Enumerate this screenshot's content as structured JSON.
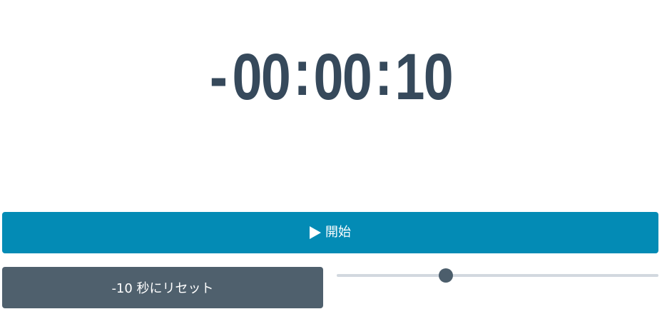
{
  "timer": {
    "sign": "-",
    "hours": "00",
    "minutes": "00",
    "seconds": "10",
    "separator": ":"
  },
  "start_button": {
    "icon": "play-icon",
    "label": "開始"
  },
  "reset_button": {
    "label": "-10 秒にリセット"
  },
  "slider": {
    "value_fraction": 0.34
  },
  "colors": {
    "timer_text": "#36495b",
    "start_button_bg": "#038bb5",
    "reset_button_bg": "#4f606d",
    "slider_track": "#d2d8df",
    "slider_thumb": "#4c5e6c"
  }
}
